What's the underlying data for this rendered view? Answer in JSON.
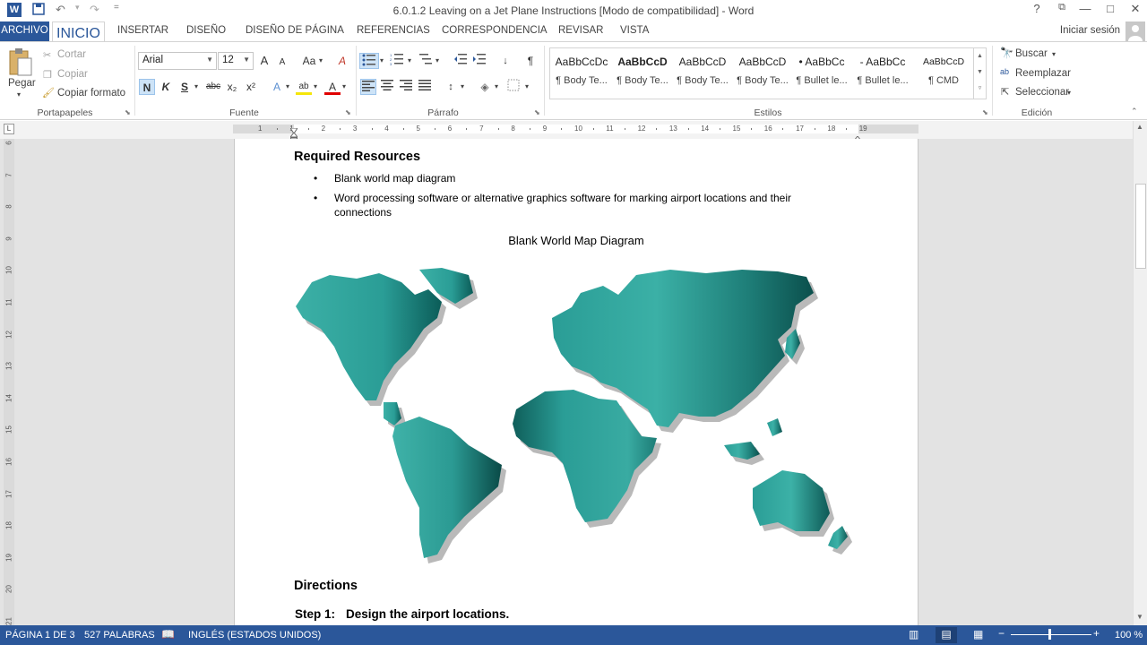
{
  "window": {
    "title": "6.0.1.2 Leaving on a Jet Plane Instructions [Modo de compatibilidad] - Word",
    "help": "?",
    "restore": "⧉",
    "minimize": "—",
    "maximize": "□",
    "close": "✕"
  },
  "qat": {
    "word_logo": "W",
    "save": "💾",
    "undo": "↶",
    "redo": "↷",
    "customize": "="
  },
  "tabs": [
    "ARCHIVO",
    "INICIO",
    "INSERTAR",
    "DISEÑO",
    "DISEÑO DE PÁGINA",
    "REFERENCIAS",
    "CORRESPONDENCIA",
    "REVISAR",
    "VISTA"
  ],
  "signin": "Iniciar sesión",
  "clipboard": {
    "paste": "Pegar",
    "cut": "Cortar",
    "copy": "Copiar",
    "format_painter": "Copiar formato",
    "label": "Portapapeles"
  },
  "font": {
    "name": "Arial",
    "size": "12",
    "label": "Fuente",
    "grow": "A",
    "shrink": "A",
    "case": "Aa",
    "clear": "A",
    "bold": "N",
    "italic": "K",
    "underline": "S",
    "strike": "abc",
    "sub": "x₂",
    "sup": "x²",
    "effects": "A",
    "highlight": "ab",
    "color": "A"
  },
  "paragraph": {
    "label": "Párrafo",
    "pilcrow": "¶"
  },
  "styles": {
    "label": "Estilos",
    "items": [
      {
        "sample": "AaBbCcDc",
        "name": "¶ Body Te..."
      },
      {
        "sample": "AaBbCcD",
        "name": "¶ Body Te..."
      },
      {
        "sample": "AaBbCcD",
        "name": "¶ Body Te..."
      },
      {
        "sample": "AaBbCcD",
        "name": "¶ Body Te..."
      },
      {
        "sample": "• AaBbCc",
        "name": "¶ Bullet le..."
      },
      {
        "sample": "- AaBbCc",
        "name": "¶ Bullet le..."
      },
      {
        "sample": "AaBbCcD",
        "name": "¶ CMD"
      }
    ]
  },
  "editing": {
    "label": "Edición",
    "find": "Buscar",
    "replace": "Reemplazar",
    "select": "Seleccionar"
  },
  "ruler": {
    "h": [
      "1",
      "1",
      "2",
      "3",
      "4",
      "5",
      "6",
      "7",
      "8",
      "9",
      "10",
      "11",
      "12",
      "13",
      "14",
      "15",
      "16",
      "17",
      "18",
      "19"
    ],
    "v": [
      "6",
      "7",
      "8",
      "9",
      "10",
      "11",
      "12",
      "13",
      "14",
      "15",
      "16",
      "17",
      "18",
      "19",
      "20",
      "21"
    ],
    "tab_selector": "L"
  },
  "doc": {
    "heading1": "Required Resources",
    "bullets": [
      "Blank world map diagram",
      "Word processing software or alternative graphics software for marking airport locations and their",
      "connections"
    ],
    "caption": "Blank World Map Diagram",
    "heading2": "Directions",
    "step_label": "Step 1:",
    "step_text": "Design the airport locations."
  },
  "status": {
    "page": "PÁGINA 1 DE 3",
    "words": "527 PALABRAS",
    "language": "INGLÉS (ESTADOS UNIDOS)",
    "zoom": "100 %"
  },
  "colors": {
    "accent": "#2b579a",
    "map_teal": "#2a9d96",
    "map_dark": "#0b4f4c"
  }
}
